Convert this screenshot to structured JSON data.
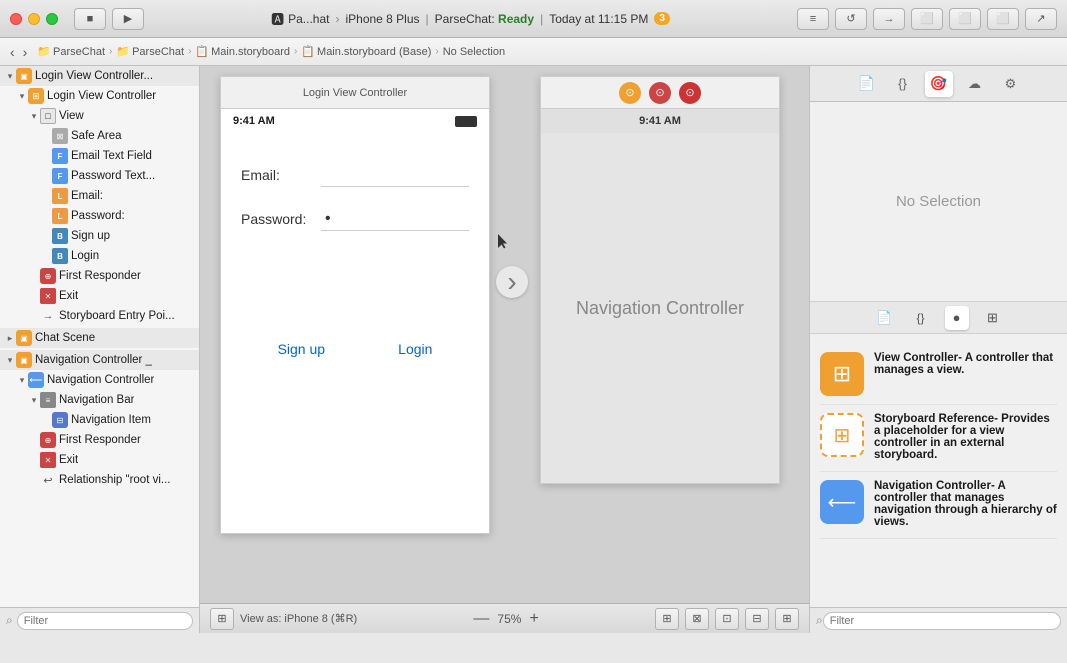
{
  "titlebar": {
    "app_name": "Pa...hat",
    "device": "iPhone 8 Plus",
    "project": "ParseChat",
    "status": "Ready",
    "time": "Today at 11:15 PM",
    "warning_count": "3",
    "stop_label": "■",
    "run_label": "▶"
  },
  "breadcrumb": {
    "items": [
      "ParseChat",
      "ParseChat",
      "Main.storyboard",
      "Main.storyboard (Base)",
      "No Selection"
    ]
  },
  "left_panel": {
    "filter_placeholder": "Filter",
    "tree": [
      {
        "id": "login-scene-header",
        "label": "Login View Controller...",
        "indent": 0,
        "type": "scene-header",
        "arrow": "open"
      },
      {
        "id": "login-vc",
        "label": "Login View Controller",
        "indent": 1,
        "type": "vc",
        "arrow": "open"
      },
      {
        "id": "view",
        "label": "View",
        "indent": 2,
        "type": "view",
        "arrow": "open"
      },
      {
        "id": "safe-area",
        "label": "Safe Area",
        "indent": 3,
        "type": "safe",
        "arrow": "none"
      },
      {
        "id": "email-field",
        "label": "Email Text Field",
        "indent": 3,
        "type": "field",
        "arrow": "none"
      },
      {
        "id": "password-field",
        "label": "Password Text...",
        "indent": 3,
        "type": "field",
        "arrow": "none"
      },
      {
        "id": "email-label",
        "label": "Email:",
        "indent": 3,
        "type": "label",
        "arrow": "none"
      },
      {
        "id": "password-label",
        "label": "Password:",
        "indent": 3,
        "type": "label",
        "arrow": "none"
      },
      {
        "id": "signup-btn",
        "label": "Sign up",
        "indent": 3,
        "type": "button",
        "arrow": "none"
      },
      {
        "id": "login-btn",
        "label": "Login",
        "indent": 3,
        "type": "button",
        "arrow": "none"
      },
      {
        "id": "first-responder",
        "label": "First Responder",
        "indent": 2,
        "type": "responder",
        "arrow": "none"
      },
      {
        "id": "exit",
        "label": "Exit",
        "indent": 2,
        "type": "exit",
        "arrow": "none"
      },
      {
        "id": "storyboard-entry",
        "label": "Storyboard Entry Poi...",
        "indent": 2,
        "type": "entry",
        "arrow": "none"
      },
      {
        "id": "chat-scene",
        "label": "Chat Scene",
        "indent": 0,
        "type": "scene-header",
        "arrow": "closed"
      },
      {
        "id": "nav-ctrl-scene",
        "label": "Navigation Controller...",
        "indent": 0,
        "type": "scene-header",
        "arrow": "open"
      },
      {
        "id": "nav-ctrl-item",
        "label": "Navigation Controller",
        "indent": 1,
        "type": "nav-ctrl",
        "arrow": "open"
      },
      {
        "id": "nav-bar",
        "label": "Navigation Bar",
        "indent": 2,
        "type": "navbar",
        "arrow": "open"
      },
      {
        "id": "nav-item",
        "label": "Navigation Item",
        "indent": 3,
        "type": "navitem",
        "arrow": "none"
      },
      {
        "id": "first-responder2",
        "label": "First Responder",
        "indent": 2,
        "type": "responder",
        "arrow": "none"
      },
      {
        "id": "exit2",
        "label": "Exit",
        "indent": 2,
        "type": "exit",
        "arrow": "none"
      },
      {
        "id": "relationship",
        "label": "Relationship \"root vi...",
        "indent": 2,
        "type": "relation",
        "arrow": "none"
      }
    ]
  },
  "canvas": {
    "login_frame_title": "Login View Controller",
    "login_status_time": "9:41 AM",
    "nav_status_time": "9:41 AM",
    "email_label": "Email:",
    "password_label": "Password:",
    "signup_btn": "Sign up",
    "login_btn": "Login",
    "nav_ctrl_label": "Navigation Controller",
    "arrow_char": "›"
  },
  "right_panel": {
    "no_selection": "No Selection",
    "tabs": [
      "📄",
      "{ }",
      "🎯",
      "☁",
      "⚙"
    ],
    "library_items": [
      {
        "title": "View Controller",
        "desc": "- A controller that manages a view.",
        "icon_type": "vc"
      },
      {
        "title": "Storyboard Reference",
        "desc": "- Provides a placeholder for a view controller in an external storyboard.",
        "icon_type": "sb"
      },
      {
        "title": "Navigation Controller",
        "desc": "- A controller that manages navigation through a hierarchy of views.",
        "icon_type": "nc"
      }
    ],
    "filter_placeholder": "Filter"
  },
  "bottom_bar": {
    "view_as": "View as: iPhone 8 (⌘R)",
    "zoom_minus": "—",
    "zoom_level": "75%",
    "zoom_plus": "+"
  }
}
